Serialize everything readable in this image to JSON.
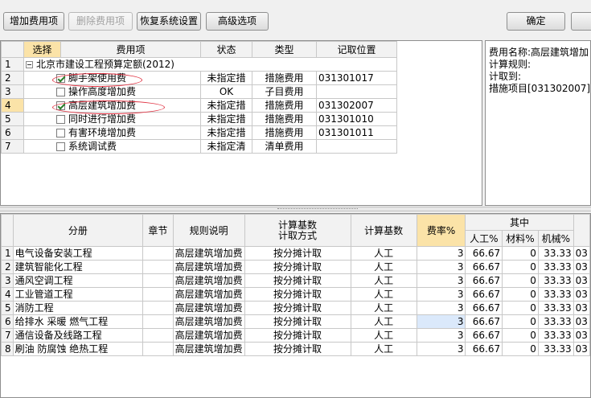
{
  "toolbar": {
    "add_fee": "增加费用项",
    "delete_fee": "删除费用项",
    "restore_settings": "恢复系统设置",
    "advanced": "高级选项",
    "ok": "确定"
  },
  "top_table": {
    "headers": [
      "选择",
      "费用项",
      "状态",
      "类型",
      "记取位置"
    ],
    "group_label": "北京市建设工程预算定额(2012)",
    "rows": [
      {
        "num": "2",
        "name": "脚手架使用费",
        "checked": true,
        "status": "未指定措",
        "type": "措施费用",
        "loc": "031301017"
      },
      {
        "num": "3",
        "name": "操作高度增加费",
        "checked": false,
        "status": "OK",
        "type": "子目费用",
        "loc": ""
      },
      {
        "num": "4",
        "name": "高层建筑增加费",
        "checked": true,
        "status": "未指定措",
        "type": "措施费用",
        "loc": "031302007"
      },
      {
        "num": "5",
        "name": "同时进行增加费",
        "checked": false,
        "status": "未指定措",
        "type": "措施费用",
        "loc": "031301010"
      },
      {
        "num": "6",
        "name": "有害环境增加费",
        "checked": false,
        "status": "未指定措",
        "type": "措施费用",
        "loc": "031301011"
      },
      {
        "num": "7",
        "name": "系统调试费",
        "checked": false,
        "status": "未指定清",
        "type": "清单费用",
        "loc": ""
      }
    ]
  },
  "info_panel": {
    "lines": [
      "费用名称:高层建筑增加",
      "计算规则:",
      "计取到:",
      "措施项目[031302007]"
    ]
  },
  "bottom_table": {
    "headers": {
      "fen_ce": "分册",
      "zhang_jie": "章节",
      "rule": "规则说明",
      "method_line1": "计算基数",
      "method_line2": "计取方式",
      "base": "计算基数",
      "rate": "费率%",
      "qizhong": "其中",
      "labor": "人工%",
      "material": "材料%",
      "machine": "机械%"
    },
    "rows": [
      {
        "num": "1",
        "fen_ce": "电气设备安装工程",
        "zhang_jie": "",
        "rule": "高层建筑增加费",
        "method": "按分摊计取",
        "base": "人工",
        "rate": "3",
        "labor": "66.67",
        "material": "0",
        "machine": "33.33",
        "extra": "03"
      },
      {
        "num": "2",
        "fen_ce": "建筑智能化工程",
        "zhang_jie": "",
        "rule": "高层建筑增加费",
        "method": "按分摊计取",
        "base": "人工",
        "rate": "3",
        "labor": "66.67",
        "material": "0",
        "machine": "33.33",
        "extra": "03"
      },
      {
        "num": "3",
        "fen_ce": "通风空调工程",
        "zhang_jie": "",
        "rule": "高层建筑增加费",
        "method": "按分摊计取",
        "base": "人工",
        "rate": "3",
        "labor": "66.67",
        "material": "0",
        "machine": "33.33",
        "extra": "03"
      },
      {
        "num": "4",
        "fen_ce": "工业管道工程",
        "zhang_jie": "",
        "rule": "高层建筑增加费",
        "method": "按分摊计取",
        "base": "人工",
        "rate": "3",
        "labor": "66.67",
        "material": "0",
        "machine": "33.33",
        "extra": "03"
      },
      {
        "num": "5",
        "fen_ce": "消防工程",
        "zhang_jie": "",
        "rule": "高层建筑增加费",
        "method": "按分摊计取",
        "base": "人工",
        "rate": "3",
        "labor": "66.67",
        "material": "0",
        "machine": "33.33",
        "extra": "03"
      },
      {
        "num": "6",
        "fen_ce": "给排水 采暖 燃气工程",
        "zhang_jie": "",
        "rule": "高层建筑增加费",
        "method": "按分摊计取",
        "base": "人工",
        "rate": "3",
        "labor": "66.67",
        "material": "0",
        "machine": "33.33",
        "extra": "03"
      },
      {
        "num": "7",
        "fen_ce": "通信设备及线路工程",
        "zhang_jie": "",
        "rule": "高层建筑增加费",
        "method": "按分摊计取",
        "base": "人工",
        "rate": "3",
        "labor": "66.67",
        "material": "0",
        "machine": "33.33",
        "extra": "03"
      },
      {
        "num": "8",
        "fen_ce": "刷油 防腐蚀 绝热工程",
        "zhang_jie": "",
        "rule": "高层建筑增加费",
        "method": "按分摊计取",
        "base": "人工",
        "rate": "3",
        "labor": "66.67",
        "material": "0",
        "machine": "33.33",
        "extra": "03"
      }
    ]
  },
  "colors": {
    "highlight": "#fbe3a8",
    "annotation_ellipse": "#e03040",
    "active_cell": "#dbe9fb"
  }
}
